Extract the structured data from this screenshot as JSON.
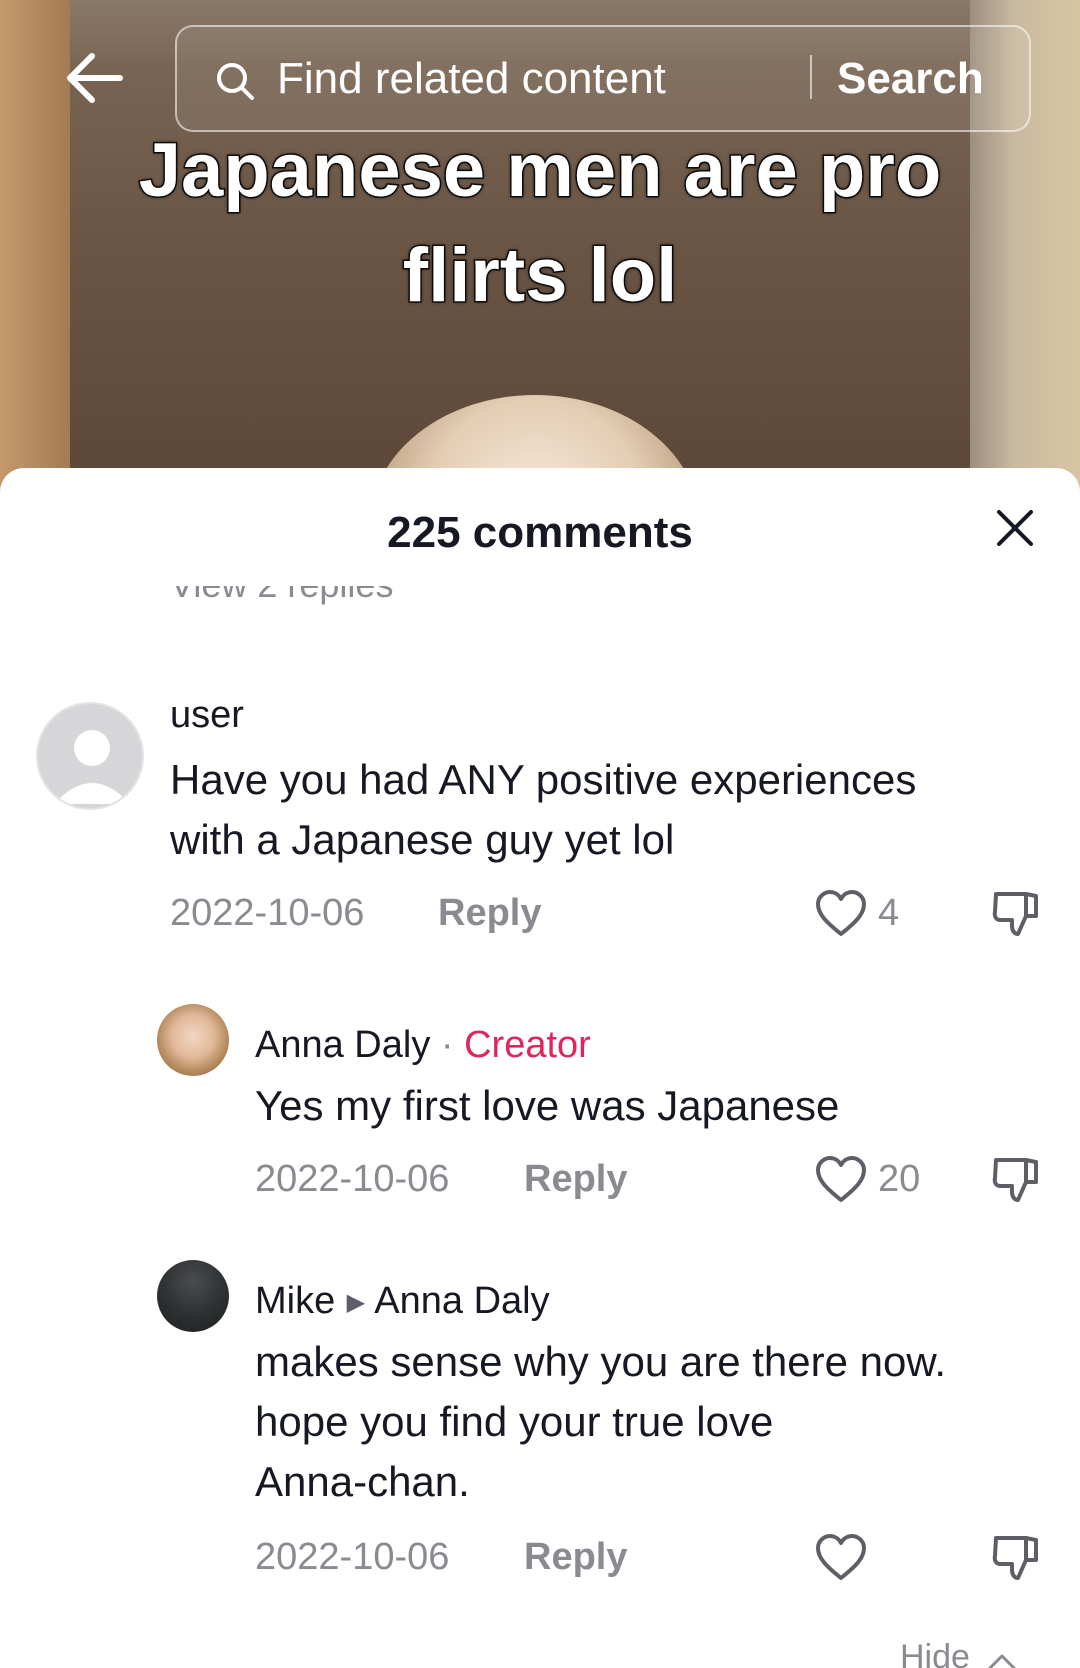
{
  "search": {
    "placeholder": "Find related content",
    "button_label": "Search"
  },
  "video": {
    "caption_line1": "Japanese men are pro",
    "caption_line2": "flirts lol"
  },
  "comments_sheet": {
    "title": "225 comments",
    "view_replies_partial": "View 2 replies",
    "hide_label": "Hide"
  },
  "comments": [
    {
      "username": "user",
      "text_line1": "Have you had ANY positive experiences",
      "text_line2": "with a Japanese guy yet lol",
      "date": "2022-10-06",
      "reply_label": "Reply",
      "likes": "4"
    },
    {
      "username": "Anna Daly",
      "badge_separator": "·",
      "badge": "Creator",
      "text_line1": "Yes my first love was Japanese",
      "date": "2022-10-06",
      "reply_label": "Reply",
      "likes": "20"
    },
    {
      "username": "Mike",
      "reply_to": "Anna Daly",
      "text_line1": "makes sense why you are there now.",
      "text_line2": "hope you find your true love",
      "text_line3": "Anna-chan.",
      "date": "2022-10-06",
      "reply_label": "Reply",
      "likes": ""
    }
  ],
  "colors": {
    "text_primary": "#161823",
    "text_secondary": "#8a8b91",
    "creator_badge": "#e0245e"
  },
  "icons": [
    "back-arrow-icon",
    "search-icon",
    "close-icon",
    "heart-icon",
    "dislike-icon",
    "chevron-up-icon"
  ]
}
